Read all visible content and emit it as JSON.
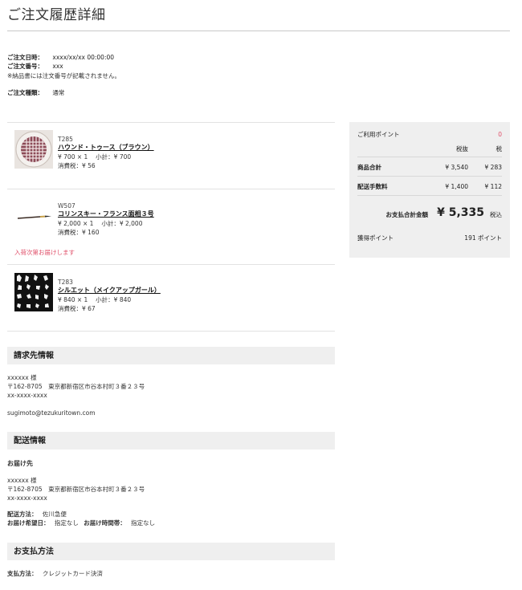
{
  "page": {
    "title": "ご注文履歴詳細"
  },
  "order": {
    "date_label": "ご注文日時：",
    "date_value": "xxxx/xx/xx 00:00:00",
    "number_label": "ご注文番号：",
    "number_value": "xxx",
    "note": "※納品書には注文番号が記載されません。",
    "type_label": "ご注文種類：",
    "type_value": "通常"
  },
  "items": [
    {
      "code": "T285",
      "name": "ハウンド・トゥース（ブラウン）",
      "price_line": "¥ 700 × 1　 小計：¥ 700",
      "tax_line": "消費税：¥ 56",
      "image_icon": "houndstooth-plate-image"
    },
    {
      "code": "W507",
      "name": "コリンスキー・フランス面相３号",
      "price_line": "¥ 2,000 × 1　 小計：¥ 2,000",
      "tax_line": "消費税：¥ 160",
      "restock_note": "入荷次第お届けします",
      "image_icon": "brush-image"
    },
    {
      "code": "T283",
      "name": "シルエット（メイクアップガール）",
      "price_line": "¥ 840 × 1　 小計：¥ 840",
      "tax_line": "消費税：¥ 67",
      "image_icon": "silhouette-pattern-image"
    }
  ],
  "billing": {
    "heading": "請求先情報",
    "name": "xxxxxx 様",
    "address": "〒162-8705　東京都新宿区市谷本村町３番２３号",
    "phone": "xx-xxxx-xxxx",
    "email": "sugimoto@tezukuritown.com"
  },
  "shipping": {
    "heading": "配送情報",
    "subheading": "お届け先",
    "name": "xxxxxx 様",
    "address": "〒162-8705　東京都新宿区市谷本村町３番２３号",
    "phone": "xx-xxxx-xxxx",
    "method_label": "配送方法：",
    "method_value": "佐川急便",
    "date_label": "お届け希望日：",
    "date_value": "指定なし",
    "time_label": "お届け時間帯：",
    "time_value": "指定なし"
  },
  "payment": {
    "heading": "お支払方法",
    "label": "支払方法：",
    "value": "クレジットカード決済"
  },
  "summary": {
    "points_used_label": "ご利用ポイント",
    "points_used_value": "0",
    "col_excl": "税抜",
    "col_tax": "税",
    "subtotal_label": "商品合計",
    "subtotal_value": "¥ 3,540",
    "subtotal_tax": "¥ 283",
    "shipping_label": "配送手数料",
    "shipping_value": "¥ 1,400",
    "shipping_tax": "¥ 112",
    "total_label": "お支払合計金額",
    "total_value": "¥ 5,335",
    "total_suffix": "税込",
    "earned_label": "獲得ポイント",
    "earned_value": "191 ポイント",
    "accent_color": "#e0506a"
  }
}
